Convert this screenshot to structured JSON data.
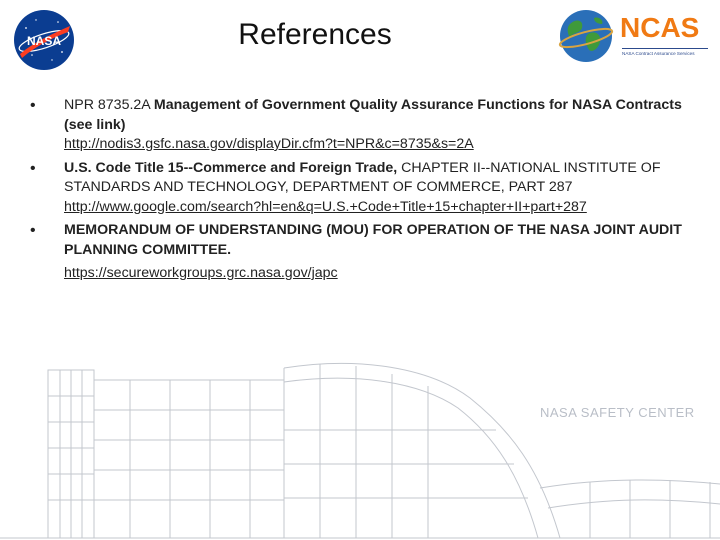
{
  "slide": {
    "title": "References",
    "logos": {
      "nasa_text": "NASA",
      "ncas_text": "NCAS",
      "ncas_subtitle": "NASA Contract Assurance Services"
    },
    "watermark_label": "NASA SAFETY CENTER",
    "bullet_char": "•"
  },
  "references": [
    {
      "prefix": "NPR 8735.2A ",
      "bold": "Management of Government Quality Assurance Functions for NASA Contracts (see link)",
      "suffix": "",
      "link": "http://nodis3.gsfc.nasa.gov/displayDir.cfm?t=NPR&c=8735&s=2A"
    },
    {
      "prefix": "",
      "bold": "U.S. Code Title 15--Commerce and Foreign Trade,",
      "suffix": " CHAPTER II--NATIONAL INSTITUTE OF STANDARDS AND TECHNOLOGY, DEPARTMENT OF COMMERCE, PART 287",
      "link": "http://www.google.com/search?hl=en&q=U.S.+Code+Title+15+chapter+II+part+287"
    },
    {
      "prefix": "",
      "bold": "MEMORANDUM OF UNDERSTANDING (MOU) FOR OPERATION OF THE NASA JOINT AUDIT PLANNING COMMITTEE",
      "suffix": ".",
      "link": "https://secureworkgroups.grc.nasa.gov/japc"
    }
  ],
  "colors": {
    "nasa_blue": "#0b3d91",
    "nasa_red": "#fc3d21",
    "ncas_orange": "#f07a14",
    "ncas_blue": "#2c4a8c",
    "drawing_line": "#c3c7ce"
  }
}
